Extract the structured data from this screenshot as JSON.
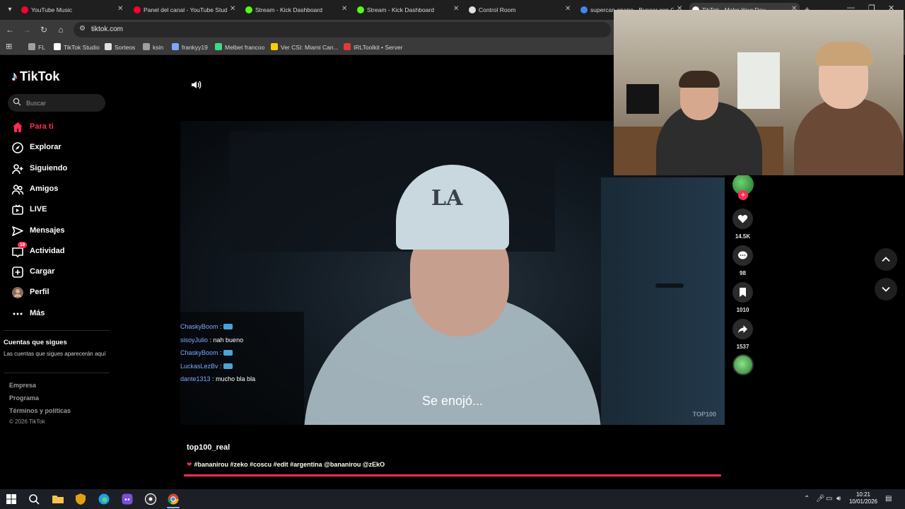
{
  "browser": {
    "tabs": [
      {
        "title": "YouTube Music",
        "color": "#ff0033"
      },
      {
        "title": "Panel del canal - YouTube Studio",
        "color": "#ff0033"
      },
      {
        "title": "Stream - Kick Dashboard",
        "color": "#53fc18"
      },
      {
        "title": "Stream - Kick Dashboard",
        "color": "#53fc18"
      },
      {
        "title": "Control Room",
        "color": "#e0e0e0"
      },
      {
        "title": "supercan enano - Buscar con Google",
        "color": "#4285f4"
      },
      {
        "title": "TikTok - Make Your Day",
        "color": "#ffffff"
      }
    ],
    "url": "tiktok.com",
    "bookmarks": [
      {
        "label": "FL",
        "color": "#9aa0a6"
      },
      {
        "label": "TikTok Studio",
        "color": "#ffffff"
      },
      {
        "label": "Sorteos",
        "color": "#e0e0e0"
      },
      {
        "label": "ksin",
        "color": "#9aa0a6"
      },
      {
        "label": "frankyy19",
        "color": "#7aa7ff"
      },
      {
        "label": "Melbet francoo",
        "color": "#3ddc84"
      },
      {
        "label": "Ver CSI: Miami Can...",
        "color": "#ffcc00"
      },
      {
        "label": "IRLToolkit • Server",
        "color": "#e53935"
      }
    ]
  },
  "tiktok": {
    "logo": "TikTok",
    "search_placeholder": "Buscar",
    "nav": [
      {
        "label": "Para ti",
        "icon": "home-icon",
        "active": true
      },
      {
        "label": "Explorar",
        "icon": "compass-icon"
      },
      {
        "label": "Siguiendo",
        "icon": "person-follow-icon"
      },
      {
        "label": "Amigos",
        "icon": "friends-icon"
      },
      {
        "label": "LIVE",
        "icon": "live-icon"
      },
      {
        "label": "Mensajes",
        "icon": "paper-plane-icon"
      },
      {
        "label": "Actividad",
        "icon": "inbox-icon",
        "badge": "19"
      },
      {
        "label": "Cargar",
        "icon": "plus-square-icon"
      },
      {
        "label": "Perfil",
        "icon": "avatar-icon"
      },
      {
        "label": "Más",
        "icon": "more-icon"
      }
    ],
    "following_title": "Cuentas que sigues",
    "following_desc": "Las cuentas que sigues aparecerán aquí",
    "footer": [
      "Empresa",
      "Programa",
      "Términos y políticas"
    ],
    "copyright": "© 2026 TikTok",
    "accent": "#fe2c55"
  },
  "video": {
    "author": "top100_real",
    "caption": "#bananirou #zeko #coscu #edit #argentina @bananirou @zEkO",
    "subtitle": "Se enojó...",
    "watermark": "TOP100",
    "cap_text": "LA",
    "progress": 1.0,
    "chat": [
      {
        "user": "ChaskyBoom",
        "msg": "",
        "chip": true
      },
      {
        "user": "sisoyJulio",
        "msg": "nah bueno",
        "chip": false
      },
      {
        "user": "ChaskyBoom",
        "msg": "",
        "chip": true
      },
      {
        "user": "LuckasLezBv",
        "msg": "",
        "chip": true
      },
      {
        "user": "dante1313",
        "msg": "mucho bla bla",
        "chip": false
      }
    ]
  },
  "actions": {
    "likes": "14.5K",
    "comments": "98",
    "saves": "1010",
    "shares": "1537"
  },
  "taskbar": {
    "time": "10:21",
    "date": "10/01/2026"
  }
}
